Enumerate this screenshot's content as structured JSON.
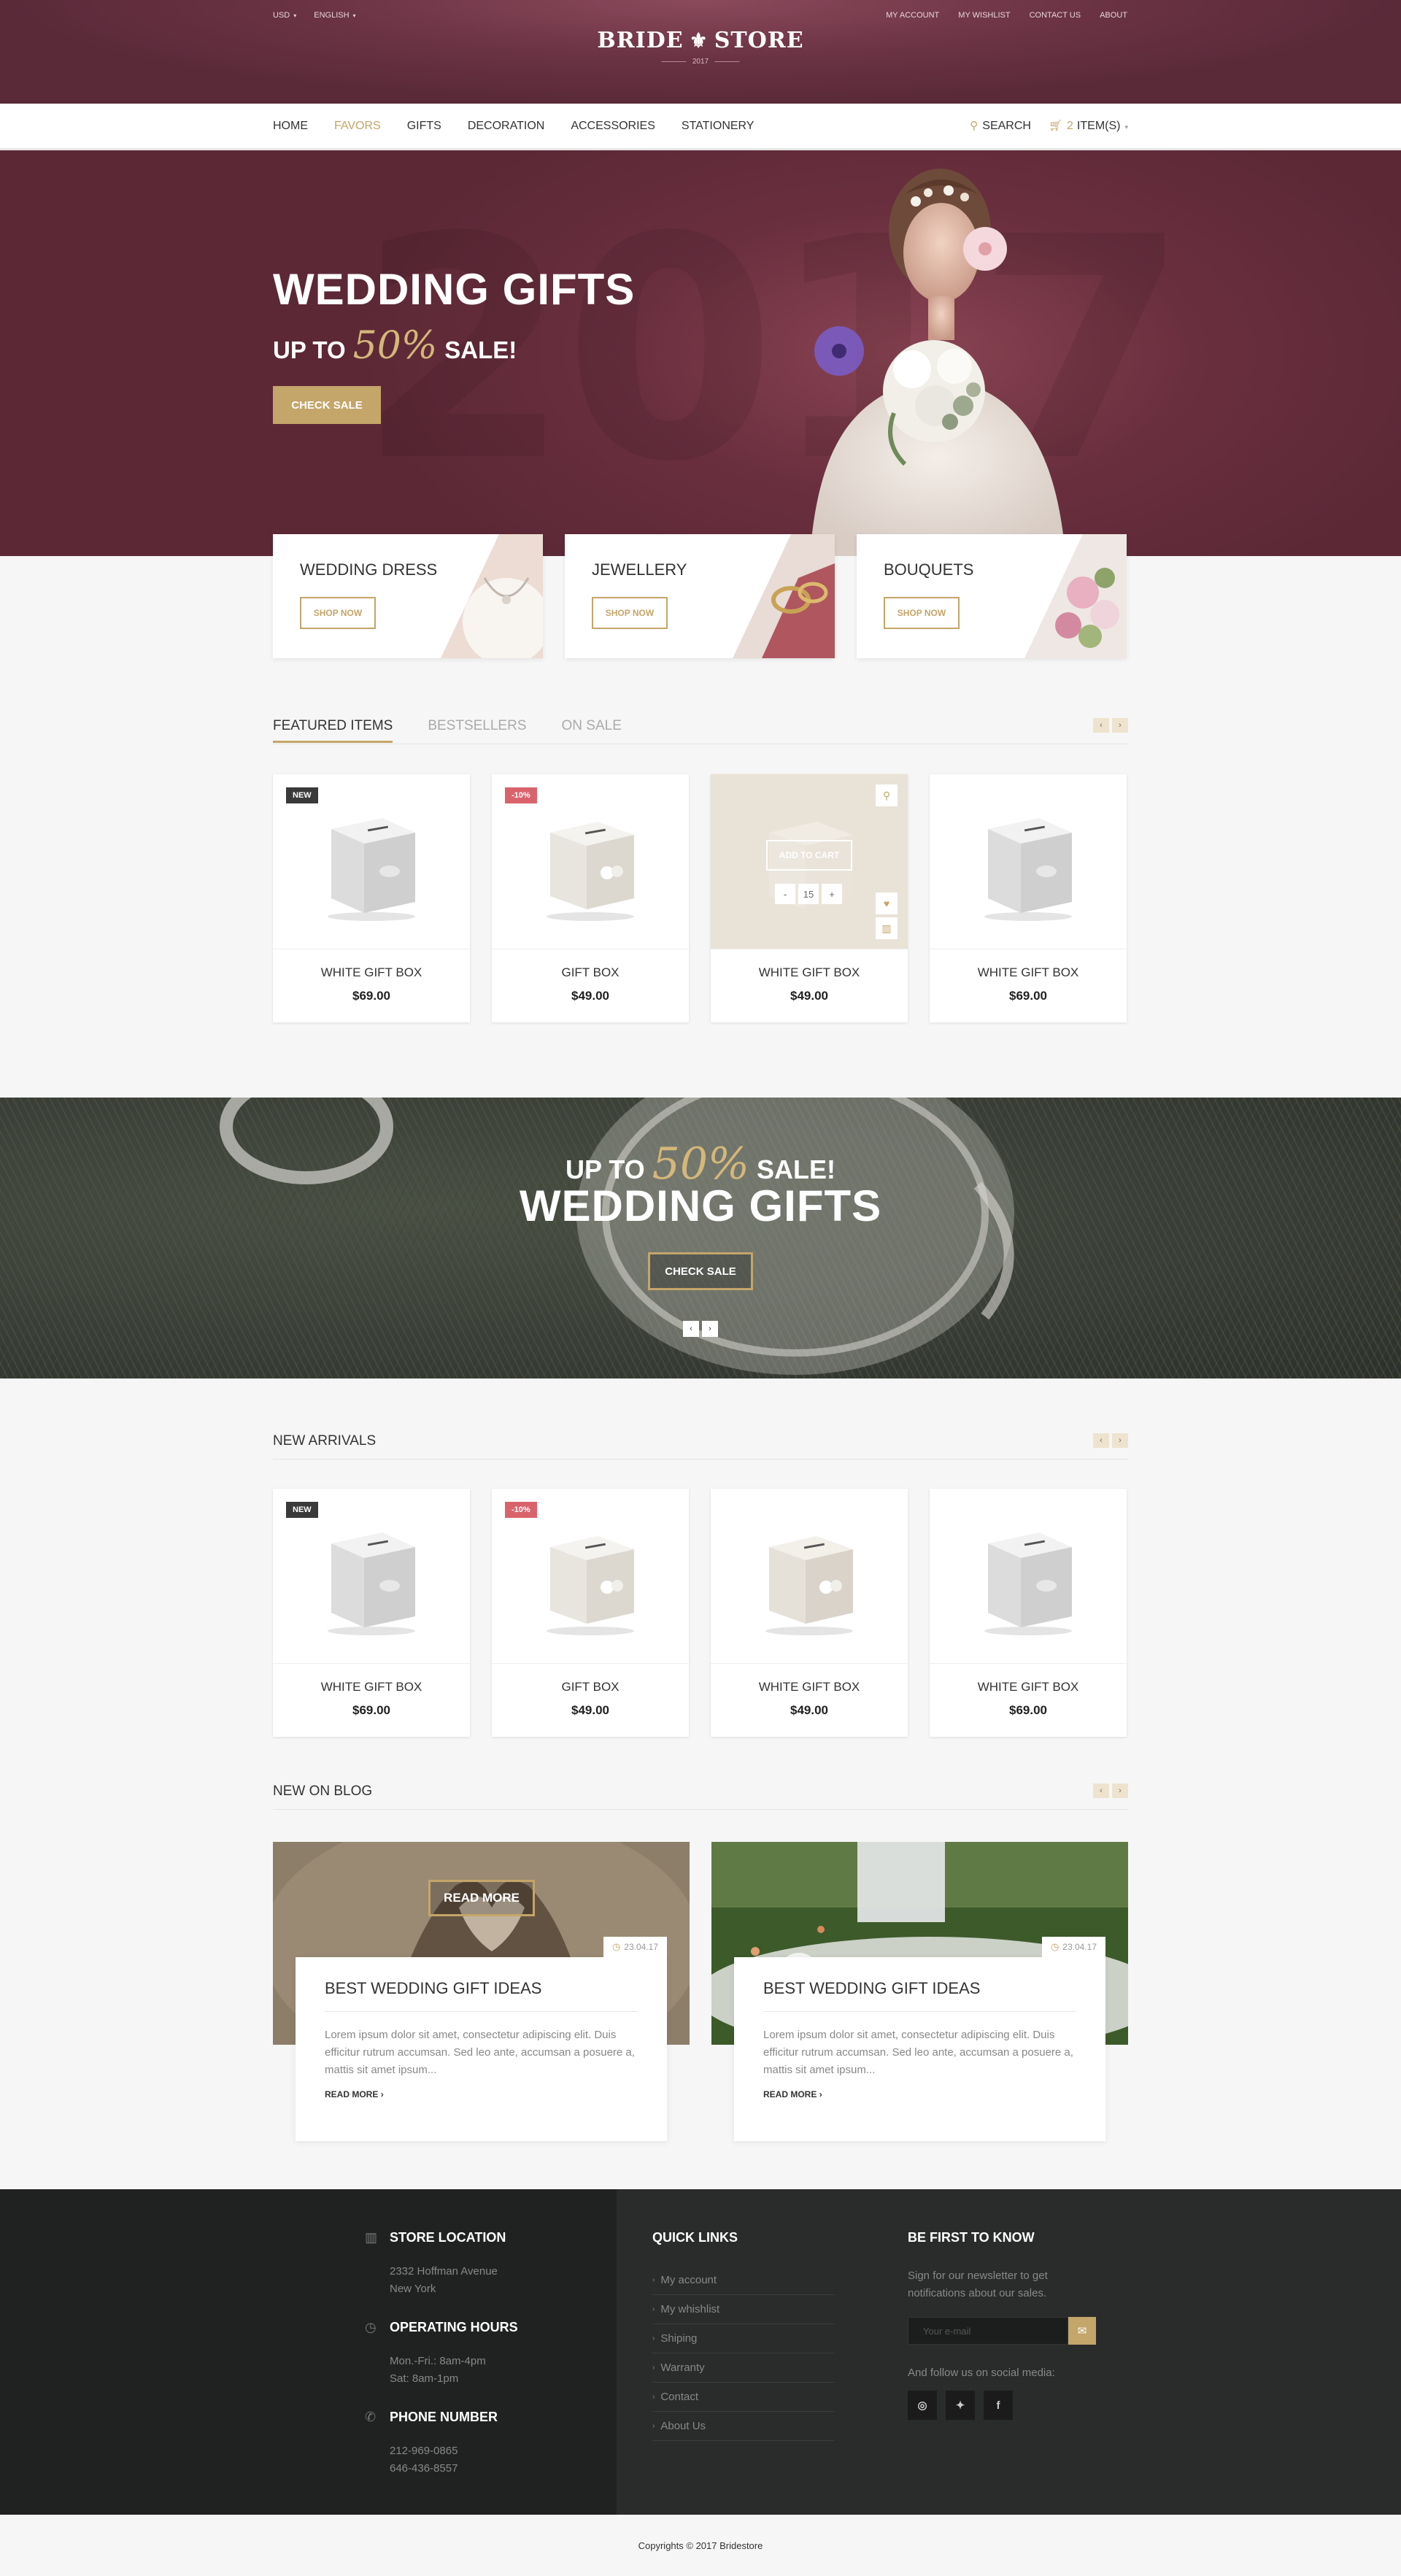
{
  "top": {
    "currency": "USD",
    "language": "ENGLISH",
    "links": [
      "MY ACCOUNT",
      "MY WISHLIST",
      "CONTACT US",
      "ABOUT"
    ],
    "logo_left": "BRIDE",
    "logo_right": "STORE",
    "logo_year": "2017"
  },
  "nav": {
    "items": [
      "HOME",
      "FAVORS",
      "GIFTS",
      "DECORATION",
      "ACCESSORIES",
      "STATIONERY"
    ],
    "search": "SEARCH",
    "cart_count": "2",
    "cart_label": "ITEM(S)"
  },
  "hero": {
    "title": "WEDDING GIFTS",
    "up_to": "UP TO",
    "pct": "50%",
    "sale": "SALE!",
    "cta": "CHECK SALE",
    "ghost": "2017"
  },
  "categories": [
    {
      "title": "WEDDING DRESS",
      "btn": "SHOP NOW"
    },
    {
      "title": "JEWELLERY",
      "btn": "SHOP NOW"
    },
    {
      "title": "BOUQUETS",
      "btn": "SHOP NOW"
    }
  ],
  "featured": {
    "tabs": [
      "FEATURED ITEMS",
      "BESTSELLERS",
      "ON SALE"
    ],
    "products": [
      {
        "name": "WHITE GIFT BOX",
        "price": "$69.00",
        "badge": "NEW"
      },
      {
        "name": "GIFT BOX",
        "price": "$49.00",
        "badge": "-10%"
      },
      {
        "name": "WHITE GIFT BOX",
        "price": "$49.00",
        "badge": ""
      },
      {
        "name": "WHITE GIFT BOX",
        "price": "$69.00",
        "badge": ""
      }
    ],
    "add_to_cart": "ADD TO CART",
    "qty_minus": "-",
    "qty_value": "15",
    "qty_plus": "+"
  },
  "promo": {
    "up_to": "UP TO",
    "pct": "50%",
    "sale": "SALE!",
    "title": "WEDDING GIFTS",
    "cta": "CHECK SALE"
  },
  "arrivals": {
    "title": "NEW ARRIVALS",
    "products": [
      {
        "name": "WHITE GIFT BOX",
        "price": "$69.00",
        "badge": "NEW"
      },
      {
        "name": "GIFT BOX",
        "price": "$49.00",
        "badge": "-10%"
      },
      {
        "name": "WHITE GIFT BOX",
        "price": "$49.00",
        "badge": ""
      },
      {
        "name": "WHITE GIFT BOX",
        "price": "$69.00",
        "badge": ""
      }
    ]
  },
  "blog": {
    "title": "NEW ON BLOG",
    "read_more_overlay": "READ MORE",
    "posts": [
      {
        "date": "23.04.17",
        "title": "BEST WEDDING GIFT IDEAS",
        "excerpt": "Lorem ipsum dolor sit amet, consectetur adipiscing elit. Duis efficitur rutrum accumsan. Sed leo ante, accumsan a posuere a, mattis sit amet ipsum...",
        "more": "READ MORE"
      },
      {
        "date": "23.04.17",
        "title": "BEST WEDDING GIFT IDEAS",
        "excerpt": "Lorem ipsum dolor sit amet, consectetur adipiscing elit. Duis efficitur rutrum accumsan. Sed leo ante, accumsan a posuere a, mattis sit amet ipsum...",
        "more": "READ MORE"
      }
    ]
  },
  "footer": {
    "location_title": "STORE LOCATION",
    "location_lines": [
      "2332 Hoffman Avenue",
      "New York"
    ],
    "hours_title": "OPERATING HOURS",
    "hours_lines": [
      "Mon.-Fri.: 8am-4pm",
      "Sat: 8am-1pm"
    ],
    "phone_title": "PHONE NUMBER",
    "phone_lines": [
      "212-969-0865",
      "646-436-8557"
    ],
    "quick_title": "QUICK LINKS",
    "quick_links": [
      "My account",
      "My whishlist",
      "Shiping",
      "Warranty",
      "Contact",
      "About Us"
    ],
    "newsletter_title": "BE FIRST TO KNOW",
    "newsletter_text": "Sign for our newsletter to get notifications about our sales.",
    "email_placeholder": "Your e-mail",
    "social_text": "And follow us on social media:",
    "copyright": "Copyrights © 2017 Bridestore"
  },
  "colors": {
    "accent": "#c4a56a",
    "brand": "#6b3344",
    "sale_badge": "#d9636c",
    "new_badge": "#3a3a3a"
  },
  "icons": [
    "search-icon",
    "cart-icon",
    "map-icon",
    "clock-icon",
    "phone-icon",
    "mail-icon",
    "instagram-icon",
    "twitter-icon",
    "facebook-icon",
    "heart-icon",
    "compare-icon",
    "zoom-icon"
  ]
}
